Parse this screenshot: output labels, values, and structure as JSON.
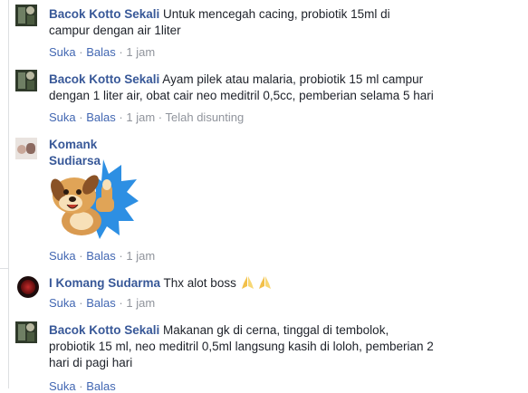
{
  "comments": [
    {
      "author": "Bacok Kotto Sekali",
      "text_line1": " Untuk mencegah cacing, probiotik 15ml di",
      "text_line2": "campur dengan air 1liter",
      "like": "Suka",
      "reply": "Balas",
      "time": "1 jam"
    },
    {
      "author": "Bacok Kotto Sekali",
      "text_line1": " Ayam pilek atau malaria, probiotik 15 ml campur",
      "text_line2": "dengan 1 liter air, obat cair neo meditril 0,5cc, pemberian selama 5 hari",
      "like": "Suka",
      "reply": "Balas",
      "time": "1 jam",
      "edited": "Telah disunting"
    },
    {
      "author": "Komank Sudiarsa",
      "sticker": "thumbs-up-dog-sticker",
      "like": "Suka",
      "reply": "Balas",
      "time": "1 jam"
    },
    {
      "author": "I Komang Sudarma",
      "text_line1": " Thx alot boss ",
      "emoji": "folded-hands-icon",
      "like": "Suka",
      "reply": "Balas",
      "time": "1 jam"
    },
    {
      "author": "Bacok Kotto Sekali",
      "text_line1": " Makanan gk di cerna, tinggal di tembolok,",
      "text_line2": "probiotik 15 ml, neo meditril 0,5ml langsung kasih di loloh, pemberian 2",
      "text_line3": "hari di pagi hari",
      "like": "Suka",
      "reply": "Balas",
      "time": ""
    }
  ],
  "separator": "·",
  "colors": {
    "author": "#385898",
    "link": "#4267b2",
    "meta": "#90949c",
    "text": "#1d2129",
    "sticker_burst": "#2d8fe3"
  }
}
